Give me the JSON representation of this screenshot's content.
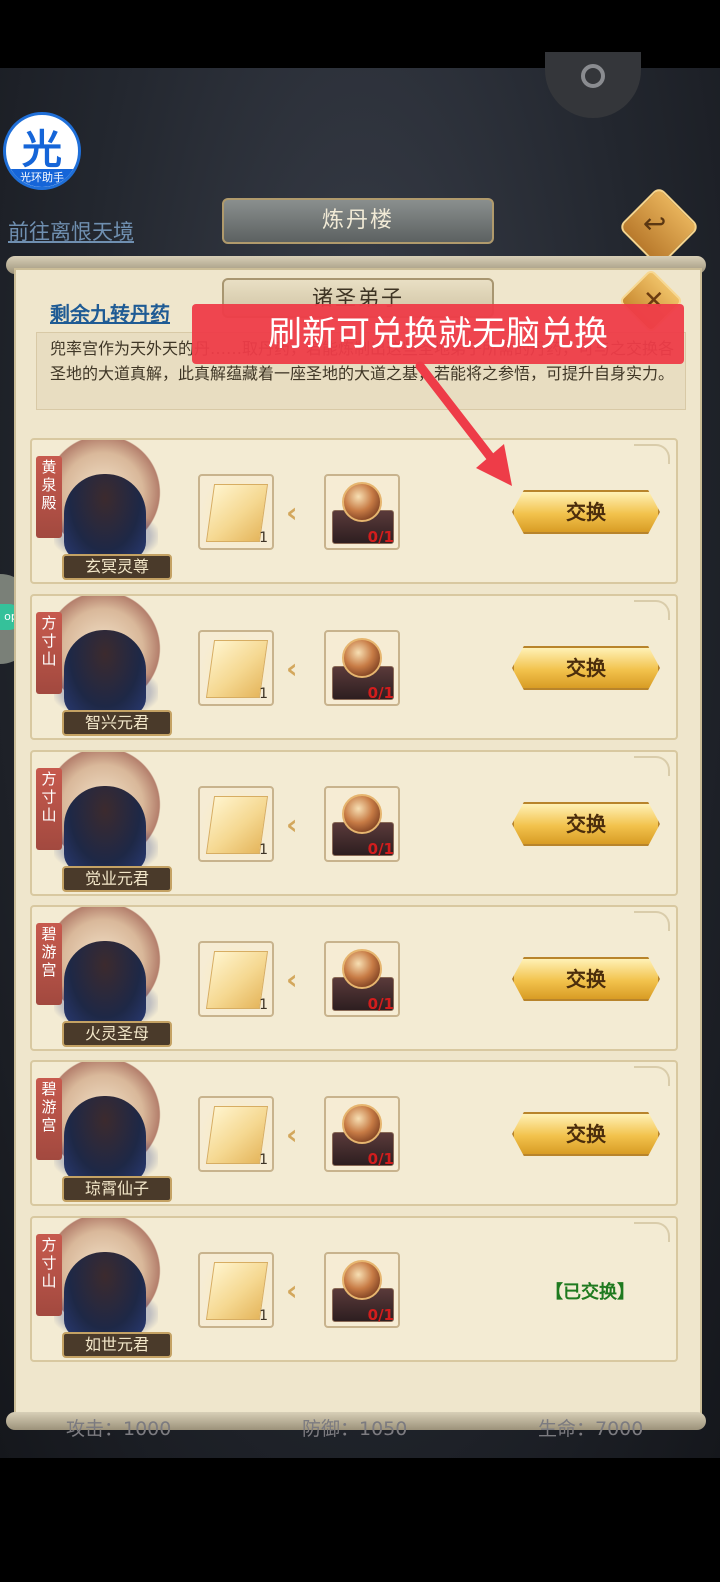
{
  "app": {
    "halo_logo_char": "光",
    "halo_logo_label": "光环助手",
    "goto_link": "前往离恨天境",
    "window_title": "炼丹楼",
    "sub_title": "诸圣弟子",
    "section_title": "剩余九转丹药",
    "description": "兜率宫作为天外天的丹……取丹药，若能炼制出这些圣地弟子所需的丹药，可与之交换各圣地的大道真解，此真解蕴藏着一座圣地的大道之基，若能将之参悟，可提升自身实力。",
    "annotation": "刷新可兑换就无脑兑换",
    "side_tab_label": "op"
  },
  "rows": [
    {
      "faction": "黄泉殿",
      "name": "玄冥灵尊",
      "reward_qty": "1",
      "cost_qty": "0/1",
      "action": "交换",
      "status": "available"
    },
    {
      "faction": "方寸山",
      "name": "智兴元君",
      "reward_qty": "1",
      "cost_qty": "0/1",
      "action": "交换",
      "status": "available"
    },
    {
      "faction": "方寸山",
      "name": "觉业元君",
      "reward_qty": "1",
      "cost_qty": "0/1",
      "action": "交换",
      "status": "available"
    },
    {
      "faction": "碧游宫",
      "name": "火灵圣母",
      "reward_qty": "1",
      "cost_qty": "0/1",
      "action": "交换",
      "status": "available"
    },
    {
      "faction": "碧游宫",
      "name": "琼霄仙子",
      "reward_qty": "1",
      "cost_qty": "0/1",
      "action": "交换",
      "status": "available"
    },
    {
      "faction": "方寸山",
      "name": "如世元君",
      "reward_qty": "1",
      "cost_qty": "0/1",
      "action": "【已交换】",
      "status": "done"
    }
  ],
  "stats": {
    "attack": "攻击：1000",
    "defense": "防御：1050",
    "hp": "生命：7000"
  },
  "colors": {
    "accent": "#f2c24c",
    "annotation_bg": "#ee3c48",
    "done": "#1f7a1f",
    "cost_red": "#d21d1d"
  }
}
